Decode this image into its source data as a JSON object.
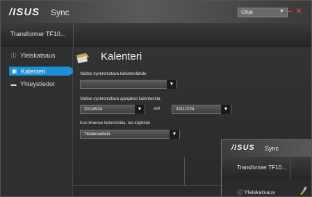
{
  "app": {
    "logo": "/ISUS",
    "name": "Sync"
  },
  "titlebar": {
    "help_label": "Ohje",
    "help_arrow": "▼",
    "controls": "–×"
  },
  "device": {
    "name": "Transformer TF10..."
  },
  "sidebar": {
    "items": [
      {
        "label": "Yleiskatsaus",
        "icon": "info-icon",
        "glyph": "ⓘ"
      },
      {
        "label": "Kalenteri",
        "icon": "calendar-icon",
        "glyph": "▣",
        "active": true
      },
      {
        "label": "Yhteystiedot",
        "icon": "contacts-icon",
        "glyph": "▬"
      }
    ]
  },
  "main": {
    "title": "Kalenteri",
    "source_label": "Valitse synkronoitava kalenterilähde",
    "source_value": "",
    "range_label": "Valitse synkronoitava ajanjakso kalenterista",
    "range_from": "2011/6/24",
    "range_to_word": "asti",
    "range_to": "2011/7/24",
    "conflict_label": "Kun ilmenee tietoristiriita, ota käyttöön",
    "conflict_value": "Tietokonetieto",
    "arrow": "▼"
  },
  "mini_window": {
    "logo": "/ISUS",
    "name": "Sync",
    "device": "Transformer TF10...",
    "nav_label": "Yleiskatsaus",
    "nav_glyph": "ⓘ"
  }
}
